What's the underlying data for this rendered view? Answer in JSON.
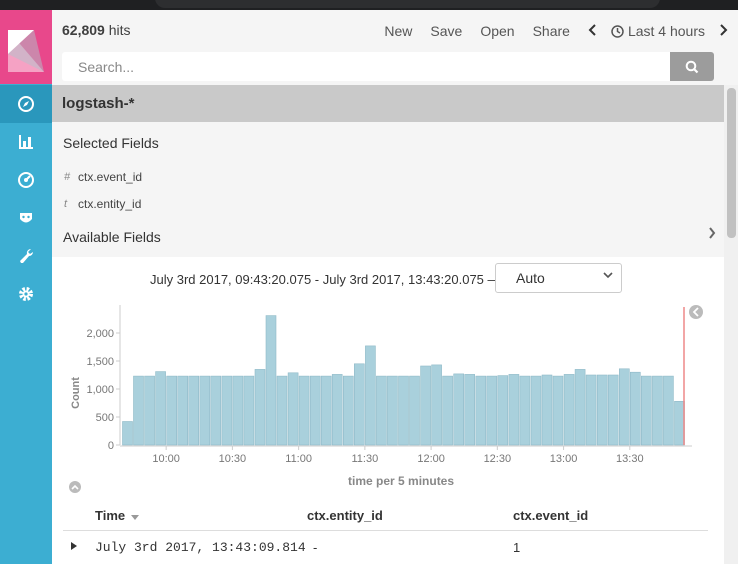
{
  "topbar": {
    "hits_count": "62,809",
    "hits_label": "hits",
    "links": [
      "New",
      "Save",
      "Open",
      "Share"
    ],
    "time_range": "Last 4 hours"
  },
  "search": {
    "placeholder": "Search..."
  },
  "index_pattern": "logstash-*",
  "fields": {
    "selected_title": "Selected Fields",
    "selected": [
      {
        "type": "#",
        "name": "ctx.event_id"
      },
      {
        "type": "t",
        "name": "ctx.entity_id"
      }
    ],
    "available_title": "Available Fields"
  },
  "chart_header": {
    "range": "July 3rd 2017, 09:43:20.075 - July 3rd 2017, 13:43:20.075 —",
    "interval": "Auto"
  },
  "chart_data": {
    "type": "bar",
    "ylabel": "Count",
    "xlabel": "time per 5 minutes",
    "ylim": [
      0,
      2500
    ],
    "yticks": [
      "0",
      "500",
      "1,000",
      "1,500",
      "2,000"
    ],
    "xticks": [
      "10:00",
      "10:30",
      "11:00",
      "11:30",
      "12:00",
      "12:30",
      "13:00",
      "13:30"
    ],
    "values": [
      420,
      1230,
      1230,
      1310,
      1230,
      1230,
      1230,
      1230,
      1230,
      1230,
      1230,
      1230,
      1350,
      2310,
      1230,
      1290,
      1230,
      1230,
      1230,
      1260,
      1230,
      1450,
      1770,
      1230,
      1230,
      1230,
      1230,
      1410,
      1430,
      1230,
      1270,
      1260,
      1230,
      1230,
      1240,
      1260,
      1230,
      1230,
      1250,
      1230,
      1260,
      1350,
      1250,
      1250,
      1250,
      1360,
      1300,
      1230,
      1230,
      1230,
      780
    ]
  },
  "table": {
    "columns": [
      "Time",
      "ctx.entity_id",
      "ctx.event_id"
    ],
    "rows": [
      {
        "time": "July 3rd 2017, 13:43:09.814",
        "entity_id": "-",
        "event_id": "1"
      }
    ]
  }
}
